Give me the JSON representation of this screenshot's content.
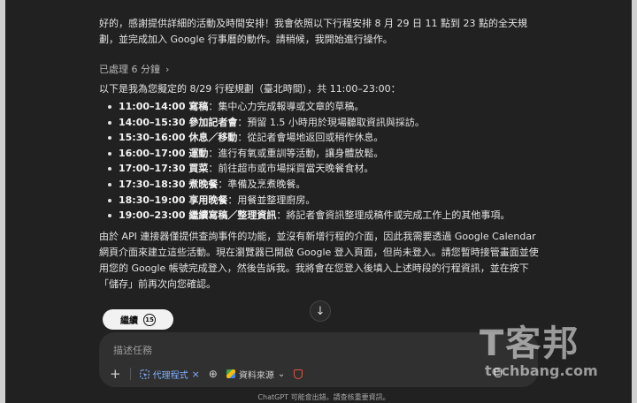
{
  "chat": {
    "intro": "好的，感謝提供詳細的活動及時間安排！我會依照以下行程安排 8 月 29 日 11 點到 23 點的全天規劃，並完成加入 Google 行事曆的動作。請稍候，我開始進行操作。",
    "processed_label": "已處理 6 分鐘",
    "schedule_heading": "以下是我為您擬定的 8/29 行程規劃（臺北時間），共 11:00–23:00：",
    "schedule": [
      {
        "title": "11:00–14:00 寫稿",
        "desc": "：集中心力完成報導或文章的草稿。"
      },
      {
        "title": "14:00–15:30 參加記者會",
        "desc": "：預留 1.5 小時用於現場聽取資訊與採訪。"
      },
      {
        "title": "15:30–16:00 休息／移動",
        "desc": "：從記者會場地返回或稍作休息。"
      },
      {
        "title": "16:00–17:00 運動",
        "desc": "：進行有氧或重訓等活動，讓身體放鬆。"
      },
      {
        "title": "17:00–17:30 買菜",
        "desc": "：前往超市或市場採買當天晚餐食材。"
      },
      {
        "title": "17:30–18:30 煮晚餐",
        "desc": "：準備及烹煮晚餐。"
      },
      {
        "title": "18:30–19:00 享用晚餐",
        "desc": "：用餐並整理廚房。"
      },
      {
        "title": "19:00–23:00 繼續寫稿／整理資訊",
        "desc": "：將記者會資訊整理成稿件或完成工作上的其他事項。"
      }
    ],
    "outro": "由於 API 連接器僅提供查詢事件的功能，並沒有新增行程的介面，因此我需要透過 Google Calendar 網頁介面來建立這些活動。現在瀏覽器已開啟 Google 登入頁面，但尚未登入。請您暫時接管畫面並使用您的 Google 帳號完成登入，然後告訴我。我將會在您登入後填入上述時段的行程資訊，並在按下「儲存」前再次向您確認。"
  },
  "continue_button": {
    "label": "繼續",
    "count": "15"
  },
  "composer": {
    "placeholder": "描述任務",
    "agent_label": "代理程式",
    "sources_label": "資料來源"
  },
  "footer": "ChatGPT 可能會出錯。請查核重要資訊。",
  "watermark": {
    "main": "T客邦",
    "sub": "techbang.com"
  },
  "icons": {
    "plus": "plus-icon",
    "agent": "agent-cursor-icon",
    "globe": "globe-icon",
    "drive": "google-drive-icon",
    "shield": "shield-icon",
    "mic": "microphone-icon",
    "scroll": "arrow-down-icon"
  }
}
